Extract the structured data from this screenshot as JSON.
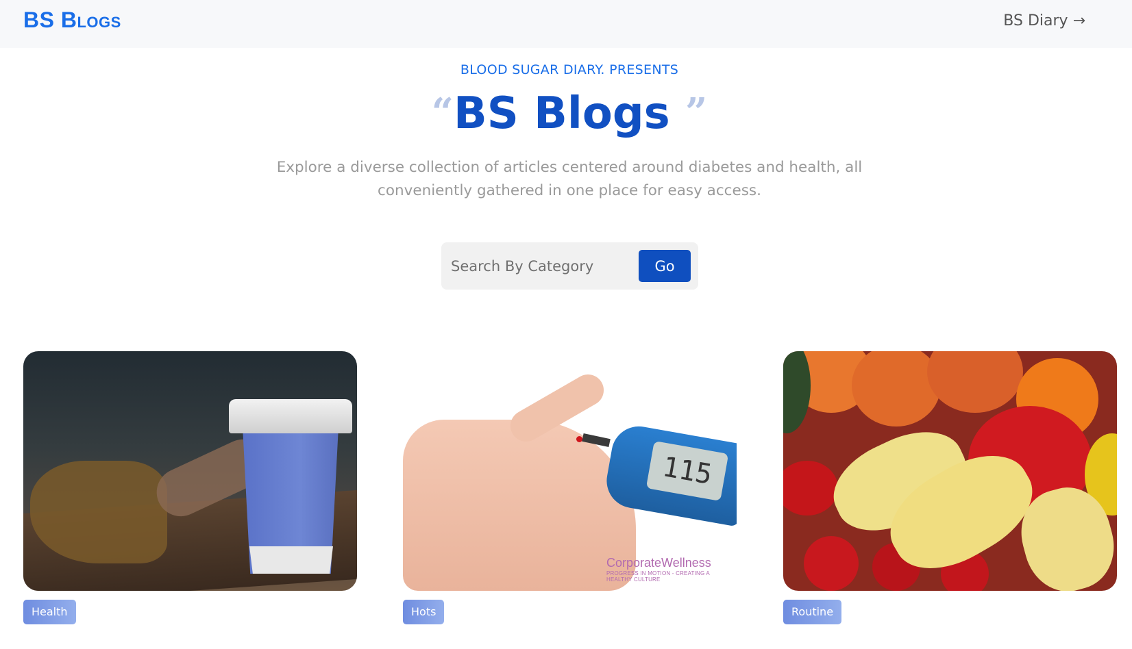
{
  "navbar": {
    "brand": "BS Blogs",
    "link_label": "BS Diary",
    "link_arrow": "→"
  },
  "hero": {
    "eyebrow": "BLOOD SUGAR DIARY. PRESENTS",
    "open_quote": "“",
    "title": "BS Blogs",
    "close_quote": "”",
    "subtitle": "Explore a diverse collection of articles centered around diabetes and health, all conveniently gathered in one place for easy access."
  },
  "search": {
    "placeholder": "Search By Category",
    "value": "",
    "button_label": "Go"
  },
  "cards": [
    {
      "image": "coffee-cup-image",
      "tag": "Health"
    },
    {
      "image": "glucose-meter-image",
      "tag": "Hots",
      "screen_reading": "115",
      "watermark_main": "CorporateWellness",
      "watermark_sub": "PROGRESS IN MOTION - CREATING A HEALTHY CULTURE"
    },
    {
      "image": "vegetables-image",
      "tag": "Routine"
    }
  ],
  "colors": {
    "brand": "#1a6ee8",
    "title": "#1150c2",
    "button": "#0f4fbf",
    "tag": "#7a96e3"
  }
}
